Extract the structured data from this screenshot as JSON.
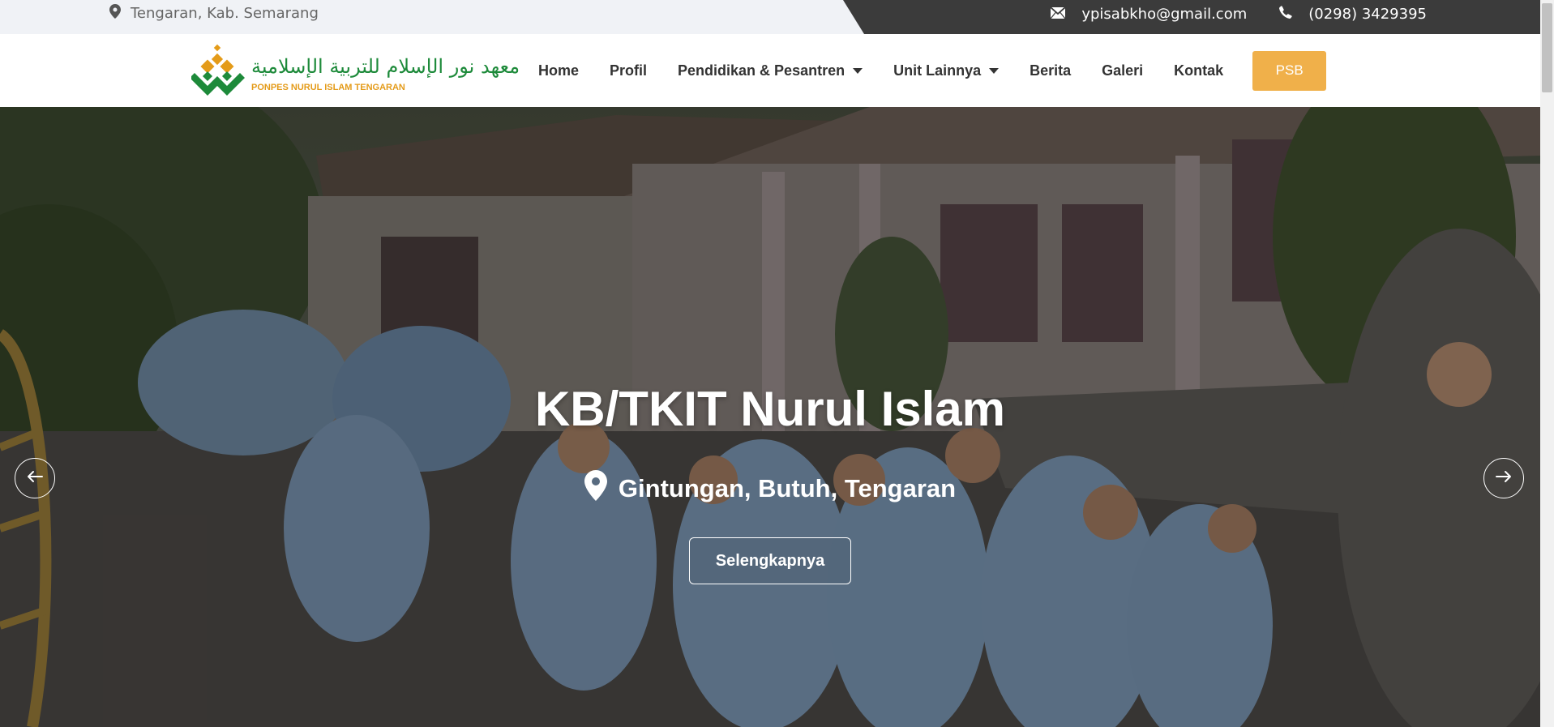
{
  "topbar": {
    "location": "Tengaran, Kab. Semarang",
    "email": "ypisabkho@gmail.com",
    "phone": "(0298) 3429395",
    "icons": {
      "location": "map-pin-icon",
      "email": "envelope-icon",
      "phone": "phone-icon"
    }
  },
  "header": {
    "logo": {
      "arabic": "معهد نور الإسلام للتربية الإسلامية",
      "subtitle": "PONPES NURUL ISLAM TENGARAN"
    },
    "nav": [
      {
        "label": "Home",
        "dropdown": false
      },
      {
        "label": "Profil",
        "dropdown": false
      },
      {
        "label": "Pendidikan & Pesantren",
        "dropdown": true
      },
      {
        "label": "Unit Lainnya",
        "dropdown": true
      },
      {
        "label": "Berita",
        "dropdown": false
      },
      {
        "label": "Galeri",
        "dropdown": false
      },
      {
        "label": "Kontak",
        "dropdown": false
      }
    ],
    "cta_label": "PSB"
  },
  "hero": {
    "title": "KB/TKIT Nurul Islam",
    "location": "Gintungan, Butuh, Tengaran",
    "button_label": "Selengkapnya"
  },
  "colors": {
    "accent": "#f0b04a",
    "logo_green": "#1d8a3a",
    "logo_orange": "#e49b19",
    "topbar_dark": "#3b3b3b",
    "topbar_light": "#f0f2f6"
  }
}
